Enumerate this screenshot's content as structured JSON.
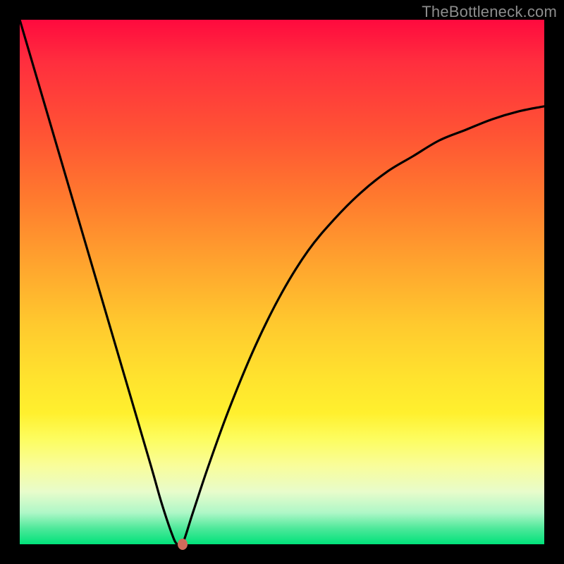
{
  "watermark": "TheBottleneck.com",
  "colors": {
    "frame": "#000000",
    "curve": "#000000",
    "marker": "#cf6b5b",
    "gradient_top": "#ff0a3e",
    "gradient_bottom": "#00e27a"
  },
  "chart_data": {
    "type": "line",
    "title": "",
    "xlabel": "",
    "ylabel": "",
    "xlim": [
      0,
      100
    ],
    "ylim": [
      0,
      100
    ],
    "grid": false,
    "legend": false,
    "series": [
      {
        "name": "bottleneck-curve",
        "x": [
          0,
          5,
          10,
          15,
          20,
          25,
          27,
          29,
          30,
          31,
          33,
          36,
          40,
          45,
          50,
          55,
          60,
          65,
          70,
          75,
          80,
          85,
          90,
          95,
          100
        ],
        "y": [
          100,
          83,
          66,
          49,
          32,
          15,
          8,
          2,
          0,
          0,
          6,
          15,
          26,
          38,
          48,
          56,
          62,
          67,
          71,
          74,
          77,
          79,
          81,
          82.5,
          83.5
        ]
      }
    ],
    "marker": {
      "x": 31,
      "y": 0
    },
    "annotations": []
  }
}
